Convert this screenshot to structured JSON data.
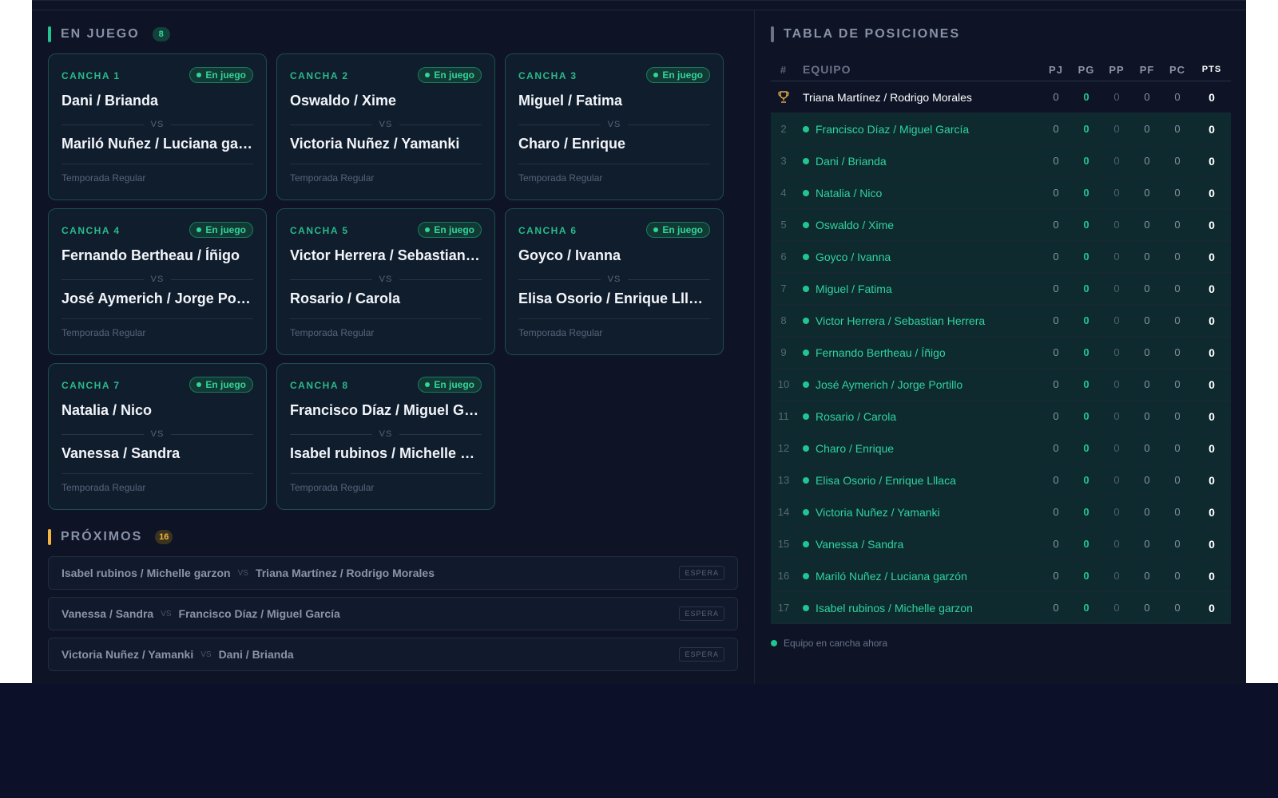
{
  "en_juego": {
    "title": "EN JUEGO",
    "count": "8",
    "cards": [
      {
        "court": "CANCHA 1",
        "status": "En juego",
        "team_a": "Dani / Brianda",
        "vs": "VS",
        "team_b": "Mariló Nuñez / Luciana garzón",
        "footer": "Temporada Regular"
      },
      {
        "court": "CANCHA 2",
        "status": "En juego",
        "team_a": "Oswaldo / Xime",
        "vs": "VS",
        "team_b": "Victoria Nuñez / Yamanki",
        "footer": "Temporada Regular"
      },
      {
        "court": "CANCHA 3",
        "status": "En juego",
        "team_a": "Miguel / Fatima",
        "vs": "VS",
        "team_b": "Charo / Enrique",
        "footer": "Temporada Regular"
      },
      {
        "court": "CANCHA 4",
        "status": "En juego",
        "team_a": "Fernando Bertheau / Íñigo",
        "vs": "VS",
        "team_b": "José Aymerich / Jorge Portillo",
        "footer": "Temporada Regular"
      },
      {
        "court": "CANCHA 5",
        "status": "En juego",
        "team_a": "Victor Herrera / Sebastian Herrera",
        "vs": "VS",
        "team_b": "Rosario / Carola",
        "footer": "Temporada Regular"
      },
      {
        "court": "CANCHA 6",
        "status": "En juego",
        "team_a": "Goyco / Ivanna",
        "vs": "VS",
        "team_b": "Elisa Osorio / Enrique Lllaca",
        "footer": "Temporada Regular"
      },
      {
        "court": "CANCHA 7",
        "status": "En juego",
        "team_a": "Natalia / Nico",
        "vs": "VS",
        "team_b": "Vanessa / Sandra",
        "footer": "Temporada Regular"
      },
      {
        "court": "CANCHA 8",
        "status": "En juego",
        "team_a": "Francisco Díaz / Miguel García",
        "vs": "VS",
        "team_b": "Isabel rubinos / Michelle garzon",
        "footer": "Temporada Regular"
      }
    ]
  },
  "proximos": {
    "title": "PRÓXIMOS",
    "count": "16",
    "items": [
      {
        "team_a": "Isabel rubinos / Michelle garzon",
        "vs": "VS",
        "team_b": "Triana Martínez / Rodrigo Morales",
        "badge": "ESPERA"
      },
      {
        "team_a": "Vanessa / Sandra",
        "vs": "VS",
        "team_b": "Francisco Díaz / Miguel García",
        "badge": "ESPERA"
      },
      {
        "team_a": "Victoria Nuñez / Yamanki",
        "vs": "VS",
        "team_b": "Dani / Brianda",
        "badge": "ESPERA"
      }
    ]
  },
  "tabla": {
    "title": "TABLA DE POSICIONES",
    "headers": {
      "rank": "#",
      "team": "EQUIPO",
      "pj": "PJ",
      "pg": "PG",
      "pp": "PP",
      "pf": "PF",
      "pc": "PC",
      "pts": "PTS"
    },
    "rows": [
      {
        "rank": "trophy-icon",
        "team": "Triana Martínez / Rodrigo Morales",
        "pj": "0",
        "pg": "0",
        "pp": "0",
        "pf": "0",
        "pc": "0",
        "pts": "0",
        "on_court": false
      },
      {
        "rank": "2",
        "team": "Francisco Díaz / Miguel García",
        "pj": "0",
        "pg": "0",
        "pp": "0",
        "pf": "0",
        "pc": "0",
        "pts": "0",
        "on_court": true
      },
      {
        "rank": "3",
        "team": "Dani / Brianda",
        "pj": "0",
        "pg": "0",
        "pp": "0",
        "pf": "0",
        "pc": "0",
        "pts": "0",
        "on_court": true
      },
      {
        "rank": "4",
        "team": "Natalia / Nico",
        "pj": "0",
        "pg": "0",
        "pp": "0",
        "pf": "0",
        "pc": "0",
        "pts": "0",
        "on_court": true
      },
      {
        "rank": "5",
        "team": "Oswaldo / Xime",
        "pj": "0",
        "pg": "0",
        "pp": "0",
        "pf": "0",
        "pc": "0",
        "pts": "0",
        "on_court": true
      },
      {
        "rank": "6",
        "team": "Goyco / Ivanna",
        "pj": "0",
        "pg": "0",
        "pp": "0",
        "pf": "0",
        "pc": "0",
        "pts": "0",
        "on_court": true
      },
      {
        "rank": "7",
        "team": "Miguel / Fatima",
        "pj": "0",
        "pg": "0",
        "pp": "0",
        "pf": "0",
        "pc": "0",
        "pts": "0",
        "on_court": true
      },
      {
        "rank": "8",
        "team": "Victor Herrera / Sebastian Herrera",
        "pj": "0",
        "pg": "0",
        "pp": "0",
        "pf": "0",
        "pc": "0",
        "pts": "0",
        "on_court": true
      },
      {
        "rank": "9",
        "team": "Fernando Bertheau / Íñigo",
        "pj": "0",
        "pg": "0",
        "pp": "0",
        "pf": "0",
        "pc": "0",
        "pts": "0",
        "on_court": true
      },
      {
        "rank": "10",
        "team": "José Aymerich / Jorge Portillo",
        "pj": "0",
        "pg": "0",
        "pp": "0",
        "pf": "0",
        "pc": "0",
        "pts": "0",
        "on_court": true
      },
      {
        "rank": "11",
        "team": "Rosario / Carola",
        "pj": "0",
        "pg": "0",
        "pp": "0",
        "pf": "0",
        "pc": "0",
        "pts": "0",
        "on_court": true
      },
      {
        "rank": "12",
        "team": "Charo / Enrique",
        "pj": "0",
        "pg": "0",
        "pp": "0",
        "pf": "0",
        "pc": "0",
        "pts": "0",
        "on_court": true
      },
      {
        "rank": "13",
        "team": "Elisa Osorio / Enrique Lllaca",
        "pj": "0",
        "pg": "0",
        "pp": "0",
        "pf": "0",
        "pc": "0",
        "pts": "0",
        "on_court": true
      },
      {
        "rank": "14",
        "team": "Victoria Nuñez / Yamanki",
        "pj": "0",
        "pg": "0",
        "pp": "0",
        "pf": "0",
        "pc": "0",
        "pts": "0",
        "on_court": true
      },
      {
        "rank": "15",
        "team": "Vanessa / Sandra",
        "pj": "0",
        "pg": "0",
        "pp": "0",
        "pf": "0",
        "pc": "0",
        "pts": "0",
        "on_court": true
      },
      {
        "rank": "16",
        "team": "Mariló Nuñez / Luciana garzón",
        "pj": "0",
        "pg": "0",
        "pp": "0",
        "pf": "0",
        "pc": "0",
        "pts": "0",
        "on_court": true
      },
      {
        "rank": "17",
        "team": "Isabel rubinos / Michelle garzon",
        "pj": "0",
        "pg": "0",
        "pp": "0",
        "pf": "0",
        "pc": "0",
        "pts": "0",
        "on_court": true
      }
    ],
    "legend": "Equipo en cancha ahora"
  },
  "colors": {
    "background": "#0e1426",
    "accent_green": "#22c58f",
    "accent_yellow": "#f5b53f",
    "card_border": "#1d4e4c",
    "trophy": "#e0a84a"
  }
}
